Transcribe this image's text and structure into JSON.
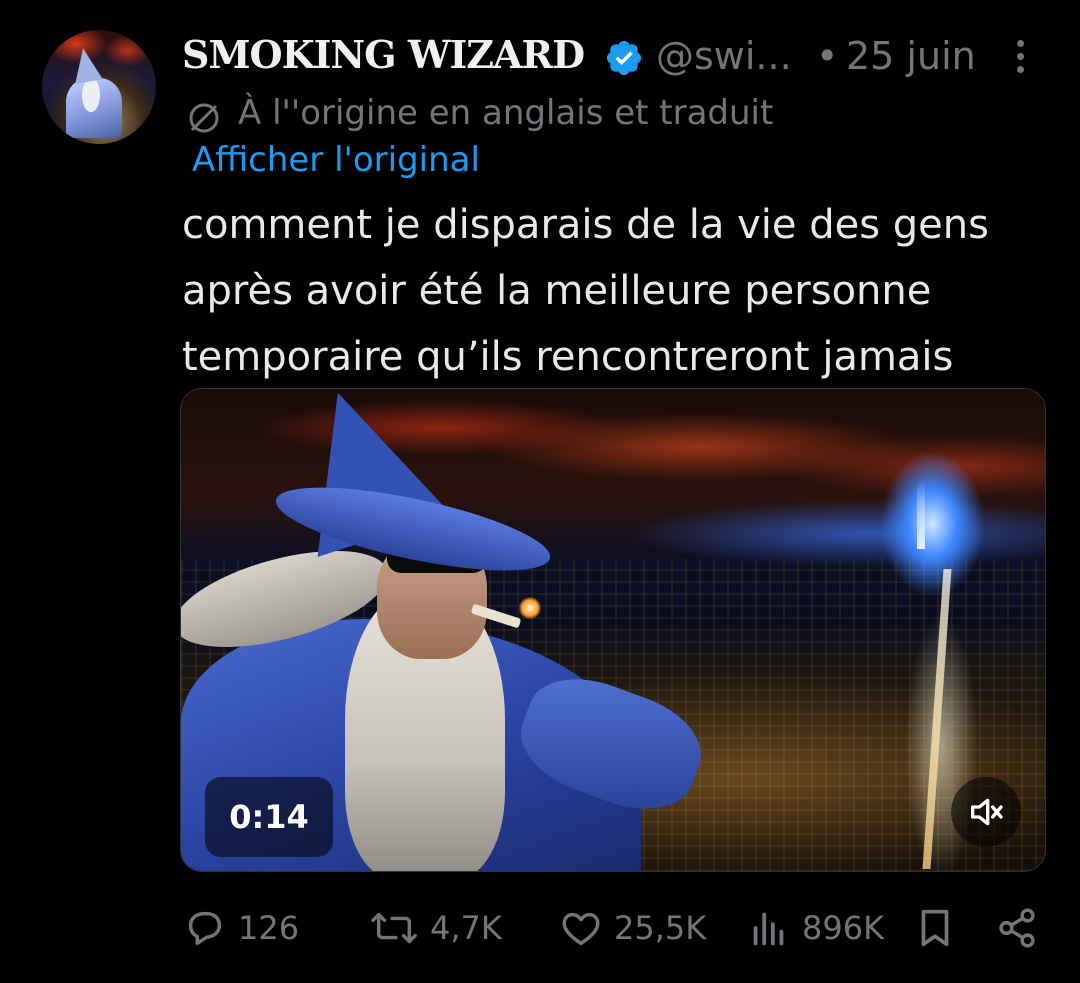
{
  "author": {
    "name": "SMOKING WIZARD",
    "handle": "@swi...",
    "separator": "•",
    "date": "25 juin"
  },
  "translation": {
    "notice": "À l''origine en anglais et traduit",
    "show_original": "Afficher l'original"
  },
  "tweet": {
    "lines": [
      "comment je disparais de la vie des gens",
      "après avoir été la meilleure personne",
      "temporaire qu’ils rencontreront jamais"
    ]
  },
  "media": {
    "duration": "0:14"
  },
  "actions": {
    "replies": "126",
    "reposts": "4,7K",
    "likes": "25,5K",
    "views": "896K"
  },
  "colors": {
    "background": "#000000",
    "text": "#e7e9ea",
    "muted": "#71767b",
    "link": "#1d9bf0",
    "verified": "#1d9bf0"
  },
  "icons": [
    "verified-badge-icon",
    "more-icon",
    "translate-icon",
    "mute-icon",
    "reply-icon",
    "repost-icon",
    "like-icon",
    "views-icon",
    "bookmark-icon",
    "share-icon"
  ]
}
